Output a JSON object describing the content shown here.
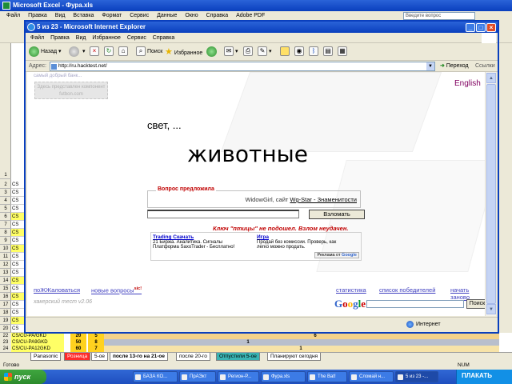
{
  "excel": {
    "title": "Microsoft Excel - Фура.xls",
    "menu": [
      "Файл",
      "Правка",
      "Вид",
      "Вставка",
      "Формат",
      "Сервис",
      "Данные",
      "Окно",
      "Справка",
      "Adobe PDF"
    ],
    "help_placeholder": "Введите вопрос",
    "row_numbers": [
      "1",
      "2",
      "3",
      "4",
      "5",
      "6",
      "7",
      "8",
      "9",
      "10",
      "11",
      "12",
      "13",
      "14",
      "15",
      "16",
      "17",
      "18",
      "19",
      "20",
      "21"
    ],
    "cell_prefix": "CS",
    "bottom_rows": [
      {
        "num": "22",
        "label": "CS/CU-PA/GKD",
        "v1": "20",
        "v2": "5",
        "v3": "6"
      },
      {
        "num": "23",
        "label": "CS/CU-PA9GKD",
        "v1": "50",
        "v2": "8",
        "v3": "1"
      },
      {
        "num": "24",
        "label": "CS/CU-PA12GKD",
        "v1": "60",
        "v2": "7",
        "v3": "1"
      }
    ],
    "sheet_tabs": [
      "Panasonic",
      "Розница",
      "5-ое",
      "после 13-го на 21-ое",
      "после 20-го",
      "Отпустили 5-ое",
      "Планируют сегодня"
    ],
    "status_left": "Готово",
    "status_num": "NUM"
  },
  "taskbar": {
    "start_label": "пуск",
    "tasks": [
      "БАЗА КО...",
      "ПрАЭкт",
      "Регион-Р...",
      "Фура.xls",
      "The Bat!",
      "Сломай н...",
      "5 из 23 -..."
    ],
    "tray_logo": "ПЛАКАТЬ"
  },
  "browser": {
    "title": "5 из 23 - Microsoft Internet Explorer",
    "menu": [
      "Файл",
      "Правка",
      "Вид",
      "Избранное",
      "Сервис",
      "Справка"
    ],
    "back_label": "Назад",
    "search_label": "Поиск",
    "favorites_label": "Избранное",
    "address_label": "Адрес:",
    "url": "http://ru.hacktest.net/",
    "go_label": "Переход",
    "links_label": "Ссылки",
    "status_zone": "Интернет"
  },
  "page": {
    "ghost_link": "самый добрый банк...",
    "ghost_box": "Здесь представлен компонент futbon.com",
    "language_link": "English",
    "greeting": "свет, ...",
    "puzzle_word": "животные",
    "question_label": "Вопрос предложила",
    "question_author": "WidowGirl, сайт",
    "question_site": "Wg-Star - Знаменитости",
    "answer_value": "",
    "submit_label": "Взломать",
    "fail_message": "Ключ \"птицы\" не подошел. Взлом неудачен.",
    "ads": [
      {
        "title": "Trading Скачать",
        "line1": "21 Биржа. Аналитика. Сигналы",
        "line2": "Платформа SaxoTrader - Бесплатно!"
      },
      {
        "title": "Игра",
        "line1": "Продай без комиссии. Проверь, как",
        "line2": "легко можно продать."
      }
    ],
    "ads_badge_prefix": "Реклама от",
    "ads_badge_brand": "Google",
    "complain_link": "поЖЖаловаться",
    "new_questions_link": "новые вопросы",
    "new_questions_badge": "sic!",
    "version": "хакерский тест v2.06",
    "right_links": [
      "статистика",
      "список победителей",
      "начать заново"
    ],
    "google_logo": [
      "G",
      "o",
      "o",
      "g",
      "l",
      "e"
    ],
    "search_value": "",
    "search_button": "Поиск"
  },
  "colors": {
    "xp_blue": "#0a3fbd",
    "fail_red": "#c00000",
    "link_blue": "#4040c0",
    "english_purple": "#800060",
    "highlight_yellow": "#ffff66"
  }
}
